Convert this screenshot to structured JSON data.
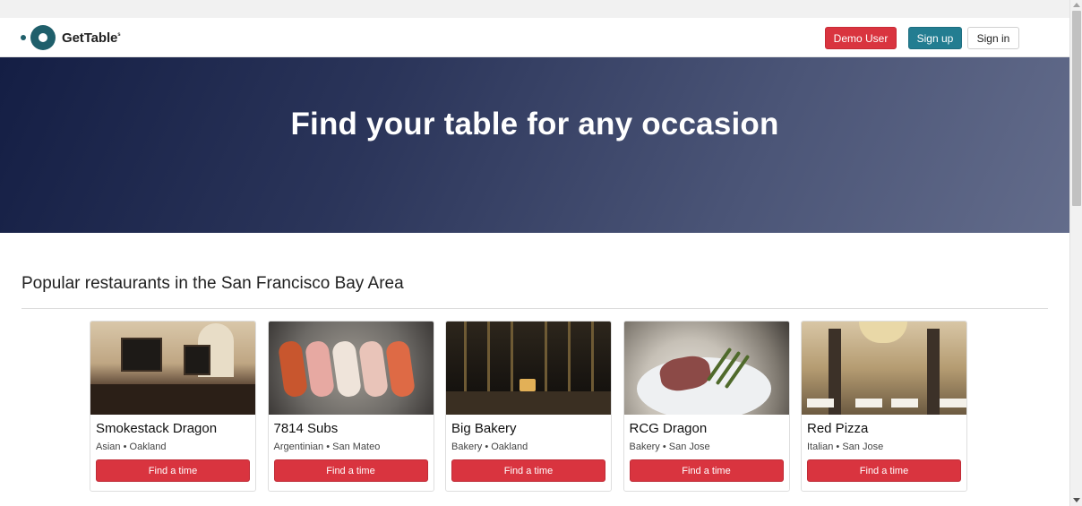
{
  "header": {
    "brand": "GetTable",
    "brand_sup": "s",
    "demo_label": "Demo User",
    "signup_label": "Sign up",
    "signin_label": "Sign in"
  },
  "hero": {
    "title": "Find your table for any occasion"
  },
  "popular": {
    "title": "Popular restaurants in the San Francisco Bay Area",
    "restaurants": [
      {
        "name": "Smokestack Dragon",
        "cuisine": "Asian",
        "city": "Oakland",
        "button": "Find a time"
      },
      {
        "name": "7814 Subs",
        "cuisine": "Argentinian",
        "city": "San Mateo",
        "button": "Find a time"
      },
      {
        "name": "Big Bakery",
        "cuisine": "Bakery",
        "city": "Oakland",
        "button": "Find a time"
      },
      {
        "name": "RCG Dragon",
        "cuisine": "Bakery",
        "city": "San Jose",
        "button": "Find a time"
      },
      {
        "name": "Red Pizza",
        "cuisine": "Italian",
        "city": "San Jose",
        "button": "Find a time"
      }
    ],
    "separator": "•"
  },
  "colors": {
    "brand_teal": "#1f5f6b",
    "demo_red": "#d9343f",
    "signup_teal": "#237d91",
    "hero_dark": "#141e44"
  },
  "icons": {
    "logo": "gettable-logo-icon"
  }
}
